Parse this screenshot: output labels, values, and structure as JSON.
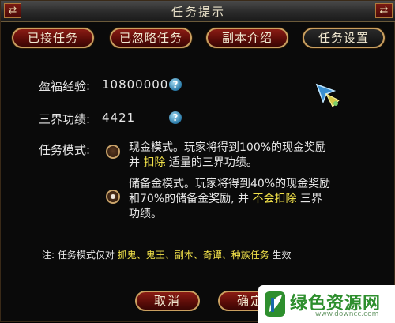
{
  "window": {
    "title": "任务提示",
    "left_icon": "⇄",
    "right_icon": "⇄"
  },
  "tabs": [
    {
      "label": "已接任务",
      "active": false
    },
    {
      "label": "已忽略任务",
      "active": false
    },
    {
      "label": "副本介绍",
      "active": false
    },
    {
      "label": "任务设置",
      "active": true
    }
  ],
  "stats": {
    "exp_label": "盈福经验:",
    "exp_value": "10800000",
    "merit_label": "三界功绩:",
    "merit_value": "4421"
  },
  "mode": {
    "label": "任务模式:",
    "option1": {
      "line1": "现金模式。玩家将得到100%的现金奖励",
      "line2_pre": "并 ",
      "line2_hl": "扣除",
      "line2_post": " 适量的三界功绩。",
      "selected": false
    },
    "option2": {
      "line1": "储备金模式。玩家将得到40%的现金奖励",
      "line2_pre": "和70%的储备金奖励, 并 ",
      "line2_hl": "不会扣除",
      "line2_post": " 三界",
      "line3": "功绩。",
      "selected": true
    }
  },
  "note": {
    "prefix": "注: 任务模式仅对 ",
    "items": "抓鬼、鬼王、副本、奇谭、种族任务",
    "suffix": " 生效"
  },
  "buttons": {
    "cancel": "取消",
    "confirm": "确定"
  },
  "watermark": {
    "text": "绿色资源网",
    "url": "www.downcc.com"
  },
  "colors": {
    "button_red": "#8a1c14",
    "border_gold": "#caa060",
    "highlight_yellow": "#f2e24a",
    "watermark_green": "#2e8f2e"
  },
  "icons": [
    "help-icon",
    "wand-cursor-icon",
    "swap-icon",
    "leaf-logo-icon"
  ]
}
